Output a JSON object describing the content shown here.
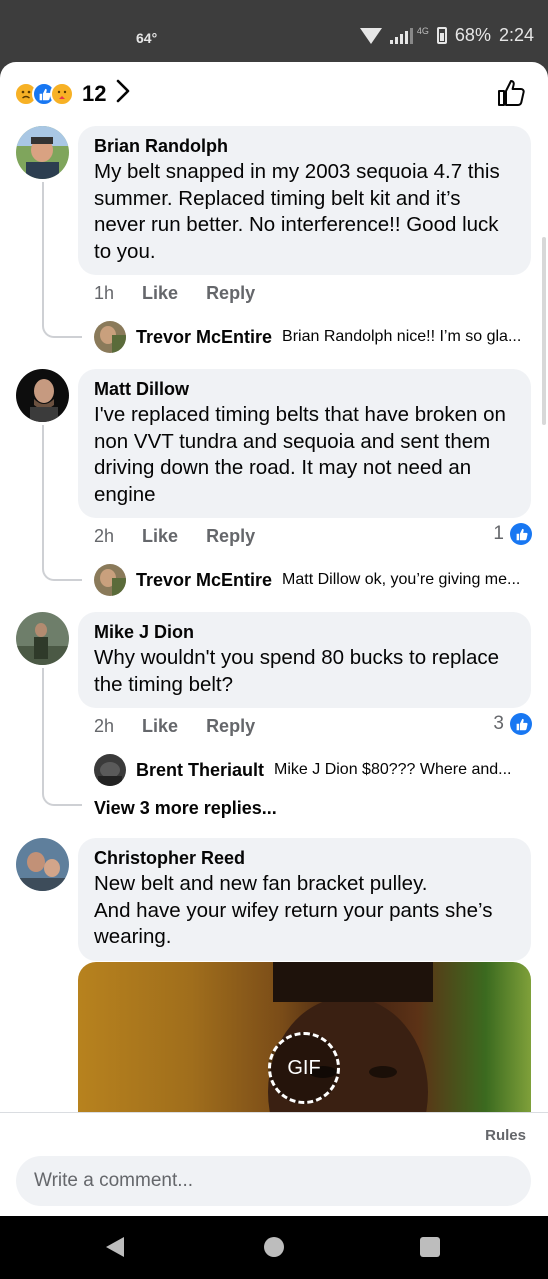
{
  "status_bar": {
    "temperature": "64°",
    "network": "4G",
    "battery": "68%",
    "time": "2:24"
  },
  "reactions": {
    "count": "12",
    "emojis": [
      "sad",
      "like",
      "care"
    ]
  },
  "comments": [
    {
      "author": "Brian Randolph",
      "text": "My belt snapped in my 2003 sequoia 4.7 this summer. Replaced timing belt kit and it’s never run better. No interference!! Good luck to you.",
      "time": "1h",
      "like_label": "Like",
      "reply_label": "Reply",
      "likes": "",
      "reply": {
        "author": "Trevor McEntire",
        "preview": "Brian Randolph nice!! I’m so gla..."
      }
    },
    {
      "author": "Matt Dillow",
      "text": "I've replaced timing belts that have broken on non VVT tundra and sequoia and sent them driving down the road. It may not need an engine",
      "time": "2h",
      "like_label": "Like",
      "reply_label": "Reply",
      "likes": "1",
      "reply": {
        "author": "Trevor McEntire",
        "preview": "Matt Dillow ok, you’re giving me..."
      }
    },
    {
      "author": "Mike J Dion",
      "text": "Why wouldn't you spend 80 bucks to replace the timing belt?",
      "time": "2h",
      "like_label": "Like",
      "reply_label": "Reply",
      "likes": "3",
      "reply": {
        "author": "Brent Theriault",
        "preview": "Mike J Dion $80??? Where and..."
      },
      "more_replies": "View 3 more replies..."
    },
    {
      "author": "Christopher Reed",
      "text_line1": "New belt and new fan bracket pulley.",
      "text_line2": "And have your wifey return your pants she’s wearing.",
      "gif_label": "GIF"
    }
  ],
  "composer": {
    "rules": "Rules",
    "placeholder": "Write a comment..."
  },
  "colors": {
    "accent": "#1877f2",
    "bubble": "#f0f2f5",
    "meta": "#65676b"
  }
}
